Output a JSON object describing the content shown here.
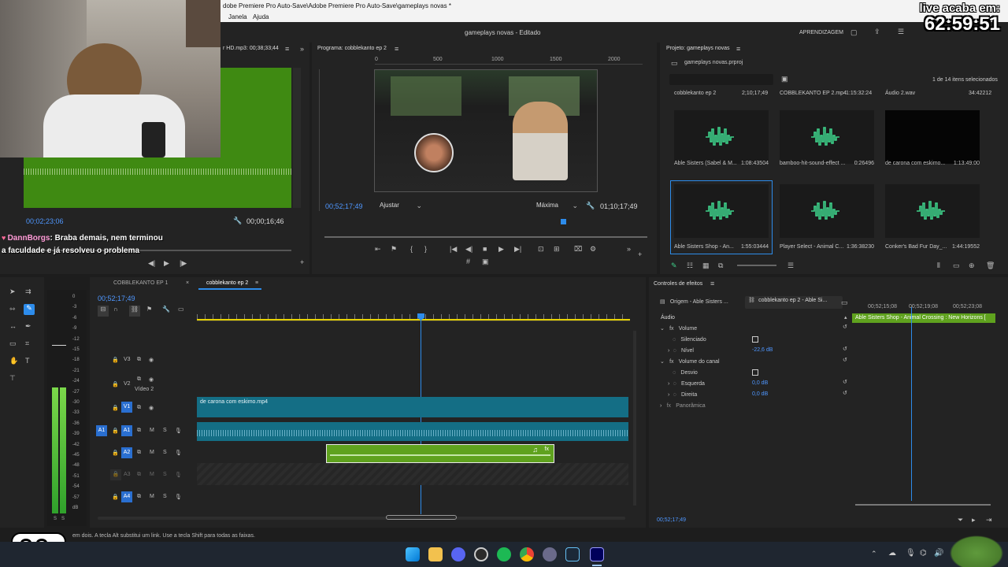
{
  "window": {
    "title": "dobe Premiere Pro Auto-Save\\Adobe Premiere Pro Auto-Save\\gameplays novas *",
    "menu": [
      "Janela",
      "Ajuda"
    ],
    "project_status": "gameplays novas - Editado",
    "workspace": "APRENDIZAGEM"
  },
  "overlay": {
    "live_label": "live acaba em:",
    "live_timer": "62:59:51"
  },
  "chat": {
    "user": "DannBorgs",
    "message": ": Braba demais, nem terminou a faculdade e já resolveu o problema"
  },
  "source": {
    "title": "r HD.mp3: 00;38;33;44",
    "timecode_left": "00;02;23;06",
    "timecode_right": "00;00;16;46"
  },
  "program": {
    "title": "Programa: cobblekanto ep 2",
    "ruler": [
      "0",
      "500",
      "1000",
      "1500",
      "2000"
    ],
    "timecode": "00;52;17;49",
    "fit": "Ajustar",
    "quality": "Máxima",
    "duration": "01;10;17;49"
  },
  "project": {
    "title": "Projeto: gameplays novas",
    "file": "gameplays novas.prproj",
    "count": "1 de 14 itens selecionados",
    "top_row": [
      {
        "name": "cobblekanto ep 2",
        "dur": "2;10;17;49"
      },
      {
        "name": "COBBLEKANTO EP 2.mp4",
        "dur": "1:15:32:24"
      },
      {
        "name": "Áudio 2.wav",
        "dur": "34:42212"
      }
    ],
    "items": [
      {
        "name": "Able Sisters (Sabel & M...",
        "dur": "1:08:43504"
      },
      {
        "name": "bamboo-hit-sound-effect ...",
        "dur": "0:26496"
      },
      {
        "name": "de carona com eskimo...",
        "dur": "1:13:49:00"
      },
      {
        "name": "Able Sisters Shop - An...",
        "dur": "1:55:03444"
      },
      {
        "name": "Player Select - Animal C...",
        "dur": "1:36:38230"
      },
      {
        "name": "Conker's Bad Fur Day_...",
        "dur": "1:44:19552"
      }
    ]
  },
  "timeline": {
    "tabs": [
      "COBBLEKANTO EP 1",
      "cobblekanto ep 2"
    ],
    "timecode": "00;52;17;49",
    "tracks": [
      {
        "id": "V3",
        "label": ""
      },
      {
        "id": "V2",
        "label": "Vídeo 2"
      },
      {
        "id": "V1",
        "label": ""
      },
      {
        "id": "A1",
        "label": ""
      },
      {
        "id": "A2",
        "label": ""
      },
      {
        "id": "A3",
        "label": ""
      },
      {
        "id": "A4",
        "label": ""
      }
    ],
    "clip_video": "de carona com eskimo.mp4",
    "meter_labels": [
      "0",
      "-3",
      "-6",
      "-9",
      "-12",
      "-15",
      "-18",
      "-21",
      "-24",
      "-27",
      "-30",
      "-33",
      "-36",
      "-39",
      "-42",
      "-45",
      "-48",
      "-51",
      "-54",
      "-57",
      "dB"
    ],
    "meter_bottom": [
      "S",
      "S"
    ]
  },
  "effects": {
    "title": "Controles de efeitos",
    "tab_source": "Origem - Able Sisters ...",
    "tab_seq": "cobblekanto ep 2 - Able Si...",
    "ruler": [
      "00;52;15;08",
      "00;52;19;08",
      "00;52;23;08"
    ],
    "clip_bar": "Able Sisters Shop - Animal Crossing : New Horizons [",
    "section": "Áudio",
    "rows": [
      {
        "label": "Volume",
        "value": ""
      },
      {
        "label": "Silenciado",
        "value": ""
      },
      {
        "label": "Nível",
        "value": "-22,6 dB"
      },
      {
        "label": "Volume do canal",
        "value": ""
      },
      {
        "label": "Desvio",
        "value": ""
      },
      {
        "label": "Esquerda",
        "value": "0,0 dB"
      },
      {
        "label": "Direita",
        "value": "0,0 dB"
      },
      {
        "label": "Panorâmica",
        "value": ""
      }
    ],
    "timecode": "00;52;17;49"
  },
  "status_bar": {
    "text": "em dois. A tecla Alt substitui um link. Use a tecla Shift para todas as faixas."
  },
  "colors": {
    "accent_blue": "#2d8ceb",
    "clip_green": "#5fa21e",
    "clip_teal": "#146e85",
    "source_green": "#3f8a12"
  }
}
